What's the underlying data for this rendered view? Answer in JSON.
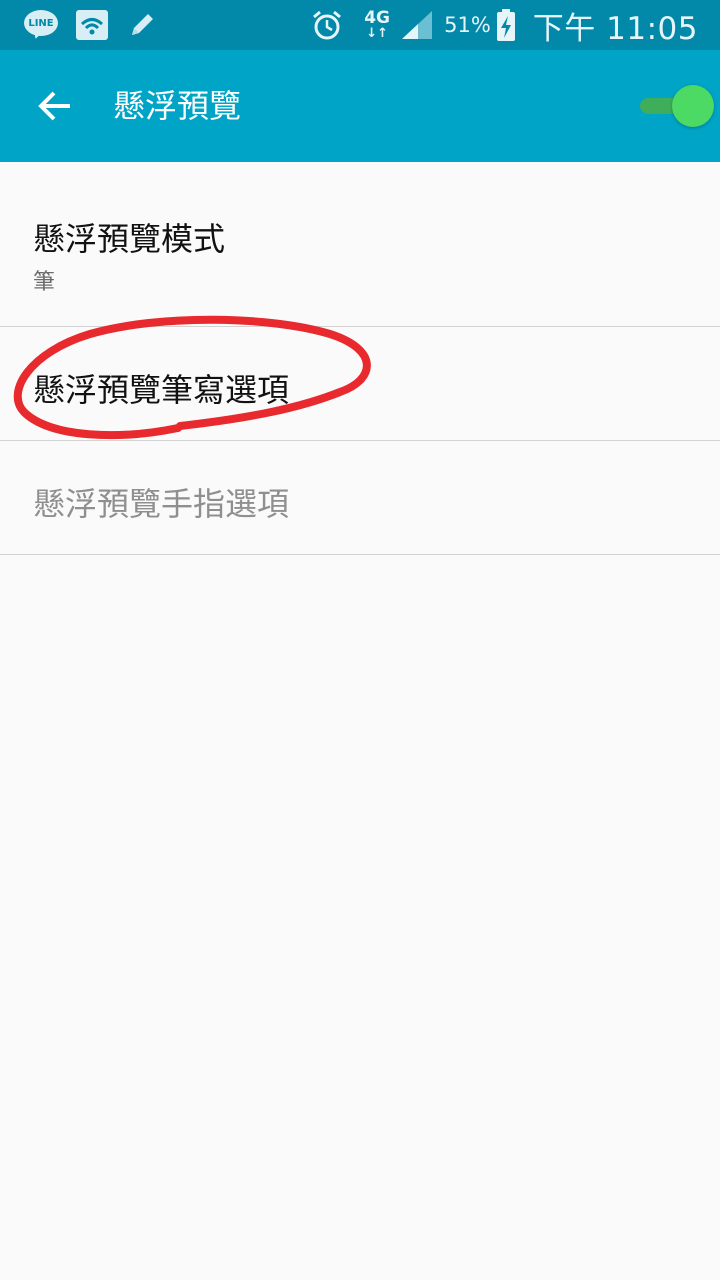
{
  "status_bar": {
    "line_label": "LINE",
    "network": "4G",
    "network_arrows": "↓↑",
    "battery": "51%",
    "time": "下午 11:05"
  },
  "app_bar": {
    "title": "懸浮預覽",
    "toggle_on": true
  },
  "settings": [
    {
      "title": "懸浮預覽模式",
      "summary": "筆",
      "enabled": true
    },
    {
      "title": "懸浮預覽筆寫選項",
      "enabled": true
    },
    {
      "title": "懸浮預覽手指選項",
      "enabled": false
    }
  ],
  "colors": {
    "status_bar": "#0288a8",
    "app_bar": "#00a4c6",
    "toggle_on": "#4cd964",
    "annotation": "#e8292e"
  },
  "icons": [
    "line-icon",
    "wifi-icon",
    "pen-icon",
    "alarm-icon",
    "signal-icon",
    "battery-charging-icon",
    "back-arrow-icon"
  ]
}
